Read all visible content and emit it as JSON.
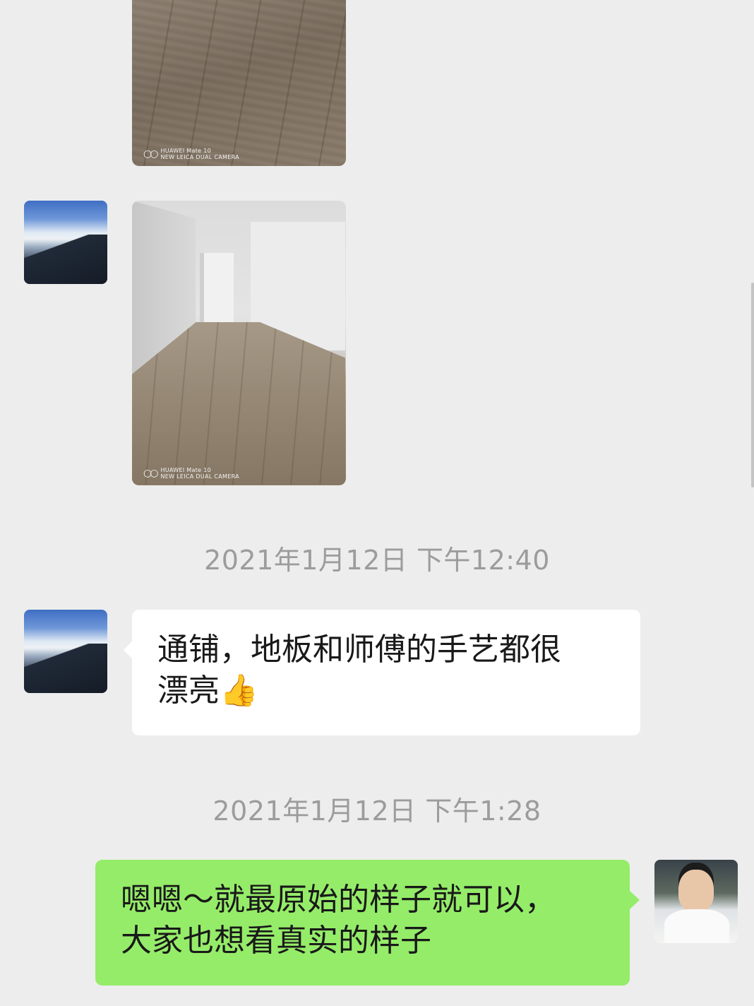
{
  "messages": [
    {
      "type": "image",
      "sender": "left",
      "watermark": {
        "line1": "HUAWEI Mate 10",
        "line2": "NEW LEICA DUAL CAMERA"
      }
    },
    {
      "type": "image",
      "sender": "left",
      "watermark": {
        "line1": "HUAWEI Mate 10",
        "line2": "NEW LEICA DUAL CAMERA"
      }
    }
  ],
  "timestamps": [
    "2021年1月12日 下午12:40",
    "2021年1月12日 下午1:28"
  ],
  "bubbles": {
    "left": {
      "line1": "通铺，地板和师傅的手艺都很",
      "line2": "漂亮",
      "emoji": "👍"
    },
    "right": {
      "line1": "嗯嗯～就最原始的样子就可以，",
      "line2": "大家也想看真实的样子"
    }
  },
  "colors": {
    "background": "#ededed",
    "bubble_in": "#ffffff",
    "bubble_out": "#95ec69",
    "timestamp_text": "#9c9c9c"
  },
  "icons": [
    "camera-rings-icon",
    "thumbs-up-emoji"
  ]
}
